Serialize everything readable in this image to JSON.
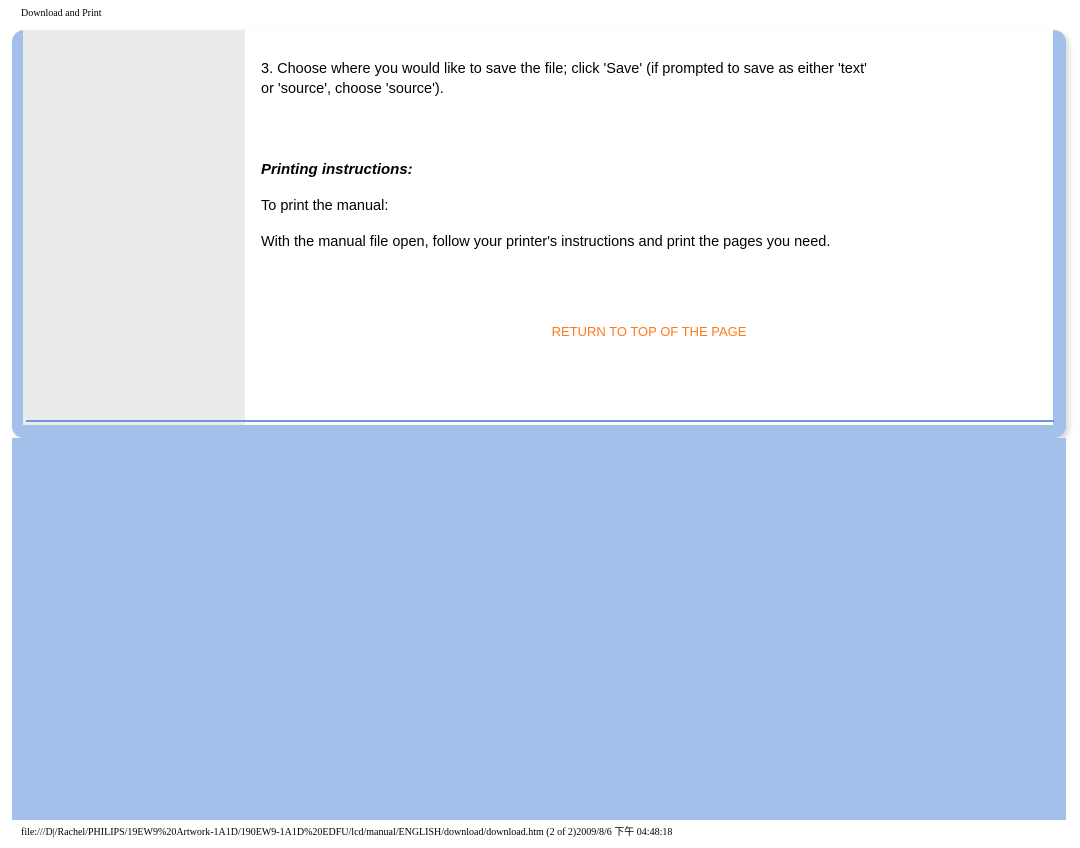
{
  "header": {
    "title": "Download and Print"
  },
  "content": {
    "save_instruction": "3. Choose where you would like to save the file; click 'Save' (if prompted to save as either 'text' or 'source', choose 'source').",
    "print_heading": "Printing instructions:",
    "print_intro": "To print the manual:",
    "print_body": "With the manual file open, follow your printer's instructions and print the pages you need.",
    "return_link": "RETURN TO TOP OF THE PAGE"
  },
  "footer": {
    "path": "file:///D|/Rachel/PHILIPS/19EW9%20Artwork-1A1D/190EW9-1A1D%20EDFU/lcd/manual/ENGLISH/download/download.htm (2 of 2)2009/8/6 下午 04:48:18"
  }
}
